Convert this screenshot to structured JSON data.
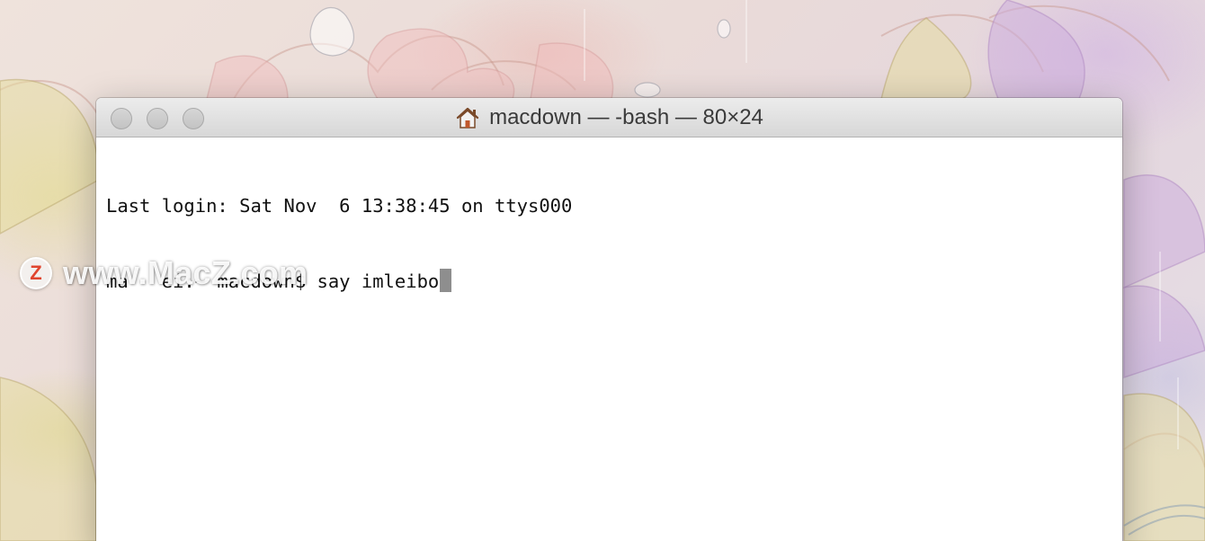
{
  "window": {
    "title": "macdown — -bash — 80×24",
    "title_icon": "home-icon",
    "traffic_lights": [
      "close",
      "minimize",
      "zoom"
    ]
  },
  "terminal": {
    "lines": [
      "Last login: Sat Nov  6 13:38:45 on ttys000",
      "ma   ei:~ macdown$ say imleibo"
    ],
    "cursor_color": "#8e8e8e"
  },
  "watermark": {
    "logo_letter": "Z",
    "text": "www.MacZ.com",
    "logo_color": "#e0452e"
  }
}
